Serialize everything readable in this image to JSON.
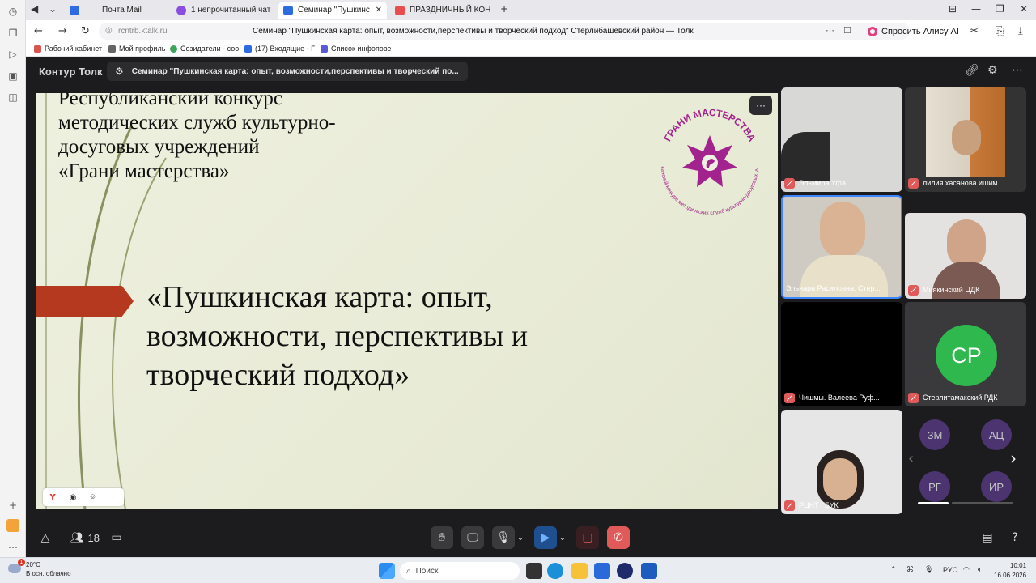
{
  "browser": {
    "tabs": [
      {
        "label": "Почта Mail",
        "color": "#2c6be0"
      },
      {
        "label": "1 непрочитанный чат",
        "color": "#8a4de0"
      },
      {
        "label": "Семинар \"Пушкинс",
        "color": "#2c6be0"
      },
      {
        "label": "ПРАЗДНИЧНЫЙ КОНЦЕ",
        "color": "#e84d4d"
      }
    ],
    "new_tab": "+",
    "address_domain": "rcntrb.ktalk.ru",
    "page_title": "Семинар \"Пушкинская карта: опыт, возможности,перспективы и творческий подход\" Стерлибашевский район — Толк",
    "alisa_label": "Спросить Алису AI",
    "bookmarks": [
      "Рабочий кабинет",
      "Мой профиль",
      "Созидатели - соо",
      "(17) Входящие - Г",
      "Список инфопове"
    ]
  },
  "app": {
    "brand": "Контур Толк",
    "meeting_title": "Семинар \"Пушкинская карта: опыт, возможности,перспективы и творческий по...",
    "participants_count": "18",
    "accent": "#3d86ff"
  },
  "slide": {
    "header_lines": [
      "Республиканский конкурс",
      "методических служб культурно-",
      "досуговых учреждений",
      "«Грани мастерства»"
    ],
    "main_lines": [
      "«Пушкинская карта: опыт,",
      "возможности, перспективы и",
      "творческий подход»"
    ],
    "logo_top_text": "ГРАНИ МАСТЕРСТВА",
    "logo_bottom_text": "Республиканский конкурс методических служб культурно-досуговых учреждений",
    "logo_color": "#a3238e",
    "menu_label": "···"
  },
  "participants": [
    {
      "name": "Эльмира Уфа"
    },
    {
      "name": "лилия хасанова ишим..."
    },
    {
      "name": "Эльнара Расиловна, Стер..."
    },
    {
      "name": "Миякинский ЦДК"
    },
    {
      "name": "Чишмы. Валеева Руф..."
    },
    {
      "name": "Стерлитамакский РДК",
      "initials": "СР"
    },
    {
      "name": "РЦНТ ГБУК"
    }
  ],
  "mini_avatars": [
    "ЗМ",
    "АЦ",
    "РГ",
    "ИР"
  ],
  "taskbar": {
    "weather_temp": "20°C",
    "weather_text": "В осн. облачно",
    "weather_badge": "1",
    "search_label": "Поиск",
    "lang": "РУС",
    "time": "10:01",
    "date": "16.06.2026"
  }
}
